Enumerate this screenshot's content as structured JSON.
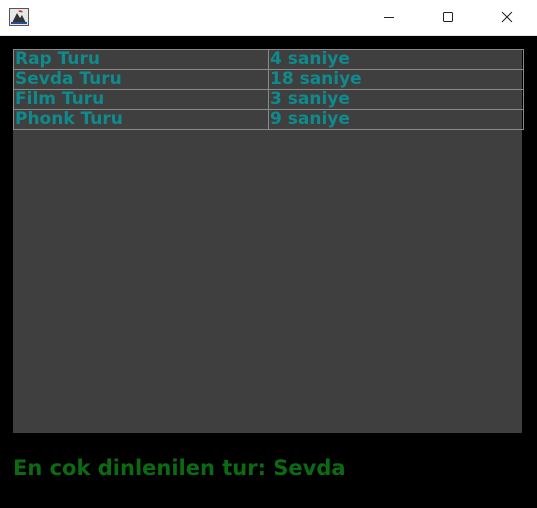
{
  "window": {
    "icon": "java-app-icon",
    "controls": {
      "minimize_icon": "minimize-icon",
      "maximize_icon": "maximize-icon",
      "close_icon": "close-icon"
    }
  },
  "colors": {
    "background": "#000000",
    "table_background": "#3f3f3f",
    "table_text": "#0f8b8d",
    "grid_line": "#8a8a8a",
    "status_text": "#0b6b12"
  },
  "table": {
    "rows": [
      {
        "genre": "Rap Turu",
        "duration": "4 saniye"
      },
      {
        "genre": "Sevda Turu",
        "duration": "18 saniye"
      },
      {
        "genre": "Film Turu",
        "duration": "3 saniye"
      },
      {
        "genre": "Phonk Turu",
        "duration": "9 saniye"
      }
    ]
  },
  "status": {
    "text": "En cok dinlenilen tur: Sevda"
  }
}
